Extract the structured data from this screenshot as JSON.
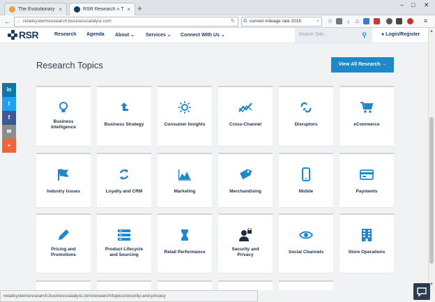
{
  "browser": {
    "tabs": [
      {
        "label": "The Evolutionary Argumen...",
        "active": false
      },
      {
        "label": "RSR Research » The Candid...",
        "active": true
      }
    ],
    "url": "retailsystemsresearch.businesscatalyst.com",
    "search_value": "current mileage rate 2016"
  },
  "site": {
    "logo_text": "RSR",
    "nav": [
      {
        "label": "Research"
      },
      {
        "label": "Agenda"
      },
      {
        "label": "About ⌄"
      },
      {
        "label": "Services ⌄"
      },
      {
        "label": "Connect With Us ⌄"
      }
    ],
    "search_placeholder": "Search Site...",
    "login_label": "Login/Register"
  },
  "page": {
    "title": "Research Topics",
    "view_all_label": "View All Research →"
  },
  "topics": [
    {
      "label": "Business\nIntelligence",
      "icon": "lightbulb-icon"
    },
    {
      "label": "Business Strategy",
      "icon": "arrow-up-icon"
    },
    {
      "label": "Consumer Insights",
      "icon": "sun-icon"
    },
    {
      "label": "Cross-Channel",
      "icon": "trend-icon"
    },
    {
      "label": "Disruptors",
      "icon": "broken-link-icon"
    },
    {
      "label": "eCommerce",
      "icon": "cart-icon"
    },
    {
      "label": "Industry Issues",
      "icon": "flag-icon"
    },
    {
      "label": "Loyalty and CRM",
      "icon": "refresh-icon"
    },
    {
      "label": "Marketing",
      "icon": "area-chart-icon"
    },
    {
      "label": "Merchandising",
      "icon": "tag-icon"
    },
    {
      "label": "Mobile",
      "icon": "phone-icon"
    },
    {
      "label": "Payments",
      "icon": "credit-card-icon"
    },
    {
      "label": "Pricing and\nPromotions",
      "icon": "pencil-icon"
    },
    {
      "label": "Product Lifecycle\nand Sourcing",
      "icon": "server-icon"
    },
    {
      "label": "Retail Performance",
      "icon": "hourglass-icon"
    },
    {
      "label": "Security and\nPrivacy",
      "icon": "user-lock-icon"
    },
    {
      "label": "Social Channels",
      "icon": "eye-icon"
    },
    {
      "label": "Store Operations",
      "icon": "building-icon"
    }
  ],
  "share": [
    {
      "label": "in",
      "color": "#0e76a8"
    },
    {
      "label": "t",
      "color": "#1da1f2"
    },
    {
      "label": "f",
      "color": "#3b5998"
    },
    {
      "label": "✉",
      "color": "#8c8c8c"
    },
    {
      "label": "+",
      "color": "#f0643c"
    }
  ],
  "status_url": "retailsystemsresearch.businesscatalyst.com/research/topics/security-and-privacy",
  "colors": {
    "accent": "#1e88c9",
    "navy": "#1b3a60"
  }
}
